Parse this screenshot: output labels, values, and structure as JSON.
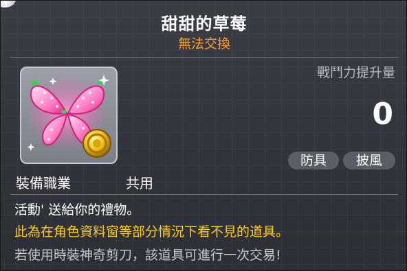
{
  "item": {
    "name": "甜甜的草莓",
    "trade_status": "無法交換",
    "icon": "strawberry-butterfly-wings-icon",
    "badge_icon": "gold-coin-icon"
  },
  "power": {
    "label": "戰鬥力提升量",
    "value": "0"
  },
  "tags": [
    {
      "label": "防具"
    },
    {
      "label": "披風"
    }
  ],
  "job": {
    "label": "裝備職業",
    "value": "共用"
  },
  "description": {
    "line1": "活動' 送給你的禮物。",
    "line2": "此為在角色資料窗等部分情況下看不見的道具。",
    "line3": "若使用時裝神奇剪刀，該道具可進行一次交易!"
  },
  "colors": {
    "trade_status": "#ff9e2a",
    "warning_text": "#ffcc1e",
    "body_text": "#ffffff",
    "muted_text": "#c4c7cd"
  }
}
